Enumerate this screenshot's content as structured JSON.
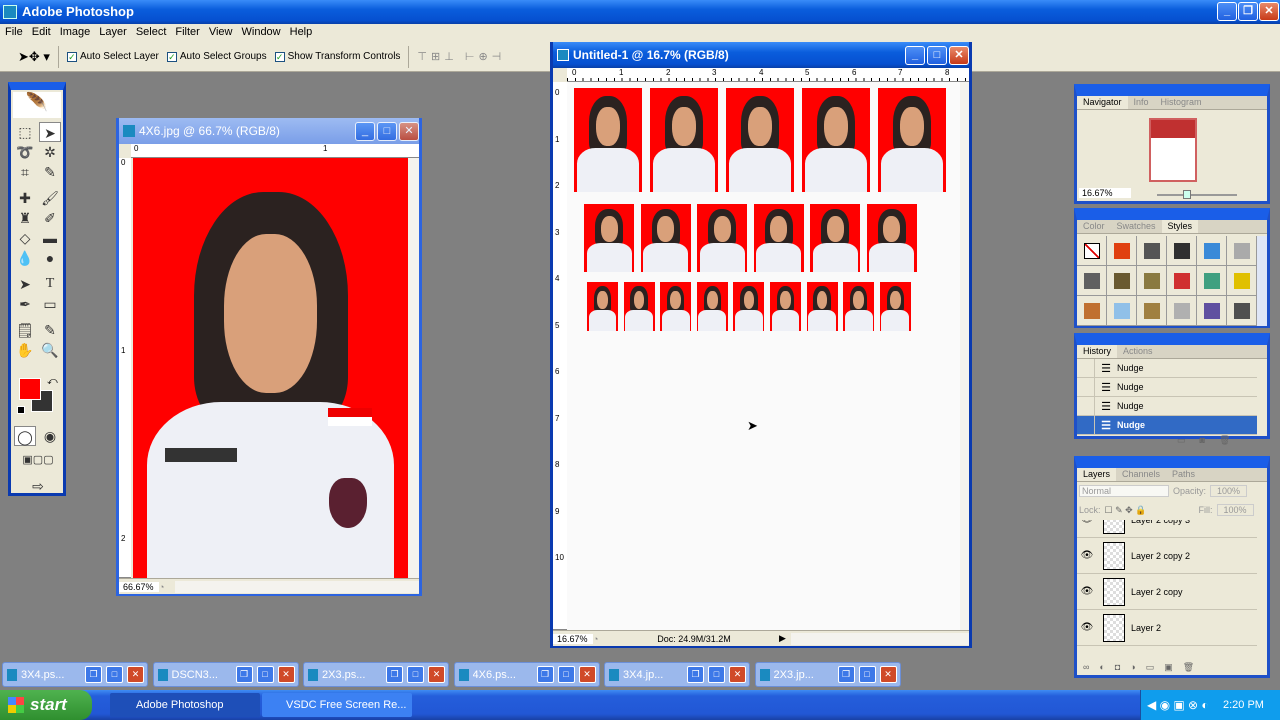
{
  "app": {
    "title": "Adobe Photoshop"
  },
  "menu": [
    "File",
    "Edit",
    "Image",
    "Layer",
    "Select",
    "Filter",
    "View",
    "Window",
    "Help"
  ],
  "options": {
    "auto_select_layer": "Auto Select Layer",
    "auto_select_groups": "Auto Select Groups",
    "show_transform_controls": "Show Transform Controls",
    "checked": [
      true,
      true,
      true
    ]
  },
  "colors": {
    "foreground": "#ff0000",
    "background": "#333333",
    "photo_bg": "#ff0000",
    "selection": "#316ac5"
  },
  "doc1": {
    "title": "4X6.jpg @ 66.7% (RGB/8)",
    "zoom": "66.67%",
    "ruler_h": [
      "0",
      "1"
    ],
    "ruler_v": [
      "0",
      "1",
      "2"
    ]
  },
  "doc2": {
    "title": "Untitled-1 @ 16.7% (RGB/8)",
    "zoom": "16.67%",
    "doc_info": "Doc: 24.9M/31.2M",
    "ruler_h": [
      "0",
      "1",
      "2",
      "3",
      "4",
      "5",
      "6",
      "7",
      "8"
    ],
    "ruler_v": [
      "0",
      "1",
      "2",
      "3",
      "4",
      "5",
      "6",
      "7",
      "8",
      "9",
      "10"
    ],
    "rows": [
      5,
      6,
      9
    ]
  },
  "navigator": {
    "tabs": [
      "Navigator",
      "Info",
      "Histogram"
    ],
    "zoom": "16.67%"
  },
  "styles": {
    "tabs": [
      "Color",
      "Swatches",
      "Styles"
    ],
    "swatches": [
      "#ffffff",
      "#e04010",
      "#555555",
      "#303030",
      "#3a8ad8",
      "#aaaaaa",
      "#606060",
      "#6a5a30",
      "#8a7a40",
      "#d03030",
      "#40a080",
      "#e0c000",
      "#c07030",
      "#90c0e8",
      "#a08040",
      "#b0b0b0",
      "#6050a0",
      "#505050"
    ]
  },
  "history": {
    "tabs": [
      "History",
      "Actions"
    ],
    "items": [
      "Nudge",
      "Nudge",
      "Nudge",
      "Nudge"
    ],
    "selected": 3
  },
  "layers": {
    "tabs": [
      "Layers",
      "Channels",
      "Paths"
    ],
    "blend_mode": "Normal",
    "opacity_label": "Opacity:",
    "opacity": "100%",
    "lock_label": "Lock:",
    "fill_label": "Fill:",
    "fill": "100%",
    "items": [
      "Layer 2 copy 3",
      "Layer 2 copy 2",
      "Layer 2 copy",
      "Layer 2"
    ]
  },
  "minimized_docs": [
    "3X4.ps...",
    "DSCN3...",
    "2X3.ps...",
    "4X6.ps...",
    "3X4.jp...",
    "2X3.jp..."
  ],
  "taskbar": {
    "start": "start",
    "items": [
      "Adobe Photoshop",
      "VSDC Free Screen Re..."
    ],
    "clock": "2:20 PM"
  }
}
